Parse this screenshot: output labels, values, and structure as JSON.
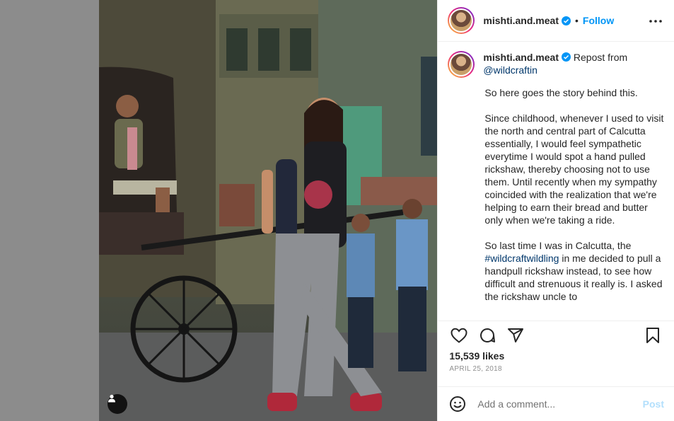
{
  "header": {
    "username": "mishti.and.meat",
    "separator": "•",
    "follow_label": "Follow",
    "more_icon": "more-horizontal-icon"
  },
  "caption": {
    "username": "mishti.and.meat",
    "repost_text": "Repost from",
    "repost_handle": "@wildcraftin",
    "paragraphs": [
      "So here goes the story behind this.",
      "Since childhood, whenever I used to visit the north and central part of Calcutta essentially, I would feel sympathetic everytime I would spot a hand pulled rickshaw, thereby choosing not to use them. Until recently when my sympathy coincided with the realization that we're helping to earn their bread and butter only when we're taking a ride."
    ],
    "para3_before": "So last time I was in Calcutta, the ",
    "hashtag": "#wildcraftwildling",
    "para3_after": " in me decided to pull a handpull rickshaw instead, to see how difficult and strenuous it really is. I asked the rickshaw uncle to"
  },
  "actions": {
    "like_icon": "heart-icon",
    "comment_icon": "comment-icon",
    "share_icon": "share-icon",
    "save_icon": "bookmark-icon"
  },
  "likes": "15,539 likes",
  "date": "APRIL 25, 2018",
  "comment_box": {
    "placeholder": "Add a comment...",
    "post_label": "Post"
  },
  "colors": {
    "accent": "#0095f6",
    "post_disabled": "#b2dffc",
    "link": "#00376b",
    "backdrop": "#8c8c8c"
  }
}
